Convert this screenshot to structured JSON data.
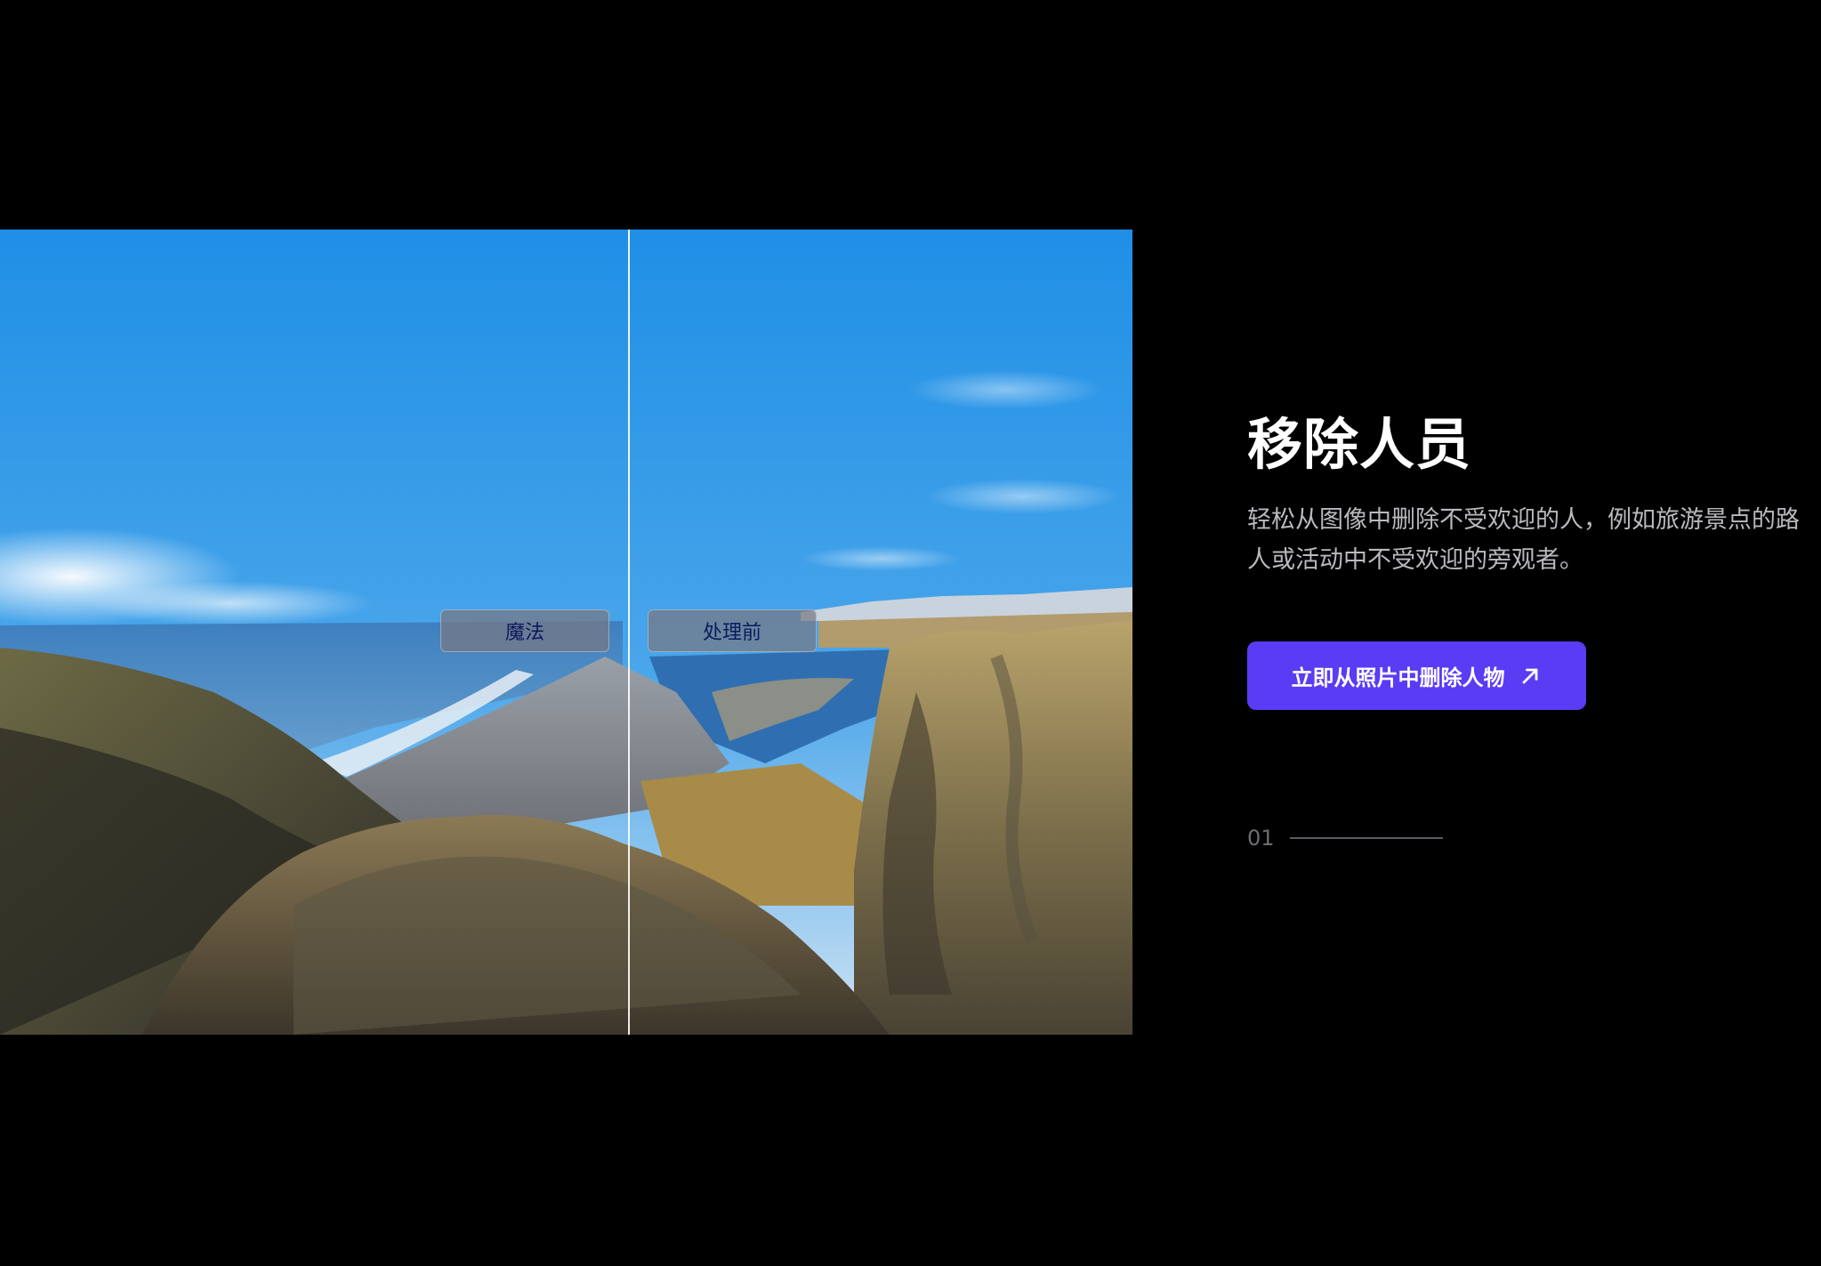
{
  "comparison": {
    "after_label": "魔法",
    "before_label": "处理前"
  },
  "feature": {
    "title": "移除人员",
    "description": "轻松从图像中删除不受欢迎的人，例如旅游景点的路人或活动中不受欢迎的旁观者。",
    "cta_label": "立即从照片中删除人物",
    "cta_icon": "arrow-up-right-icon",
    "step_number": "01"
  },
  "colors": {
    "background": "#000000",
    "accent": "#5a3cf5",
    "title": "#ffffff",
    "description": "#b9b9bf",
    "step": "#6d6d74"
  }
}
